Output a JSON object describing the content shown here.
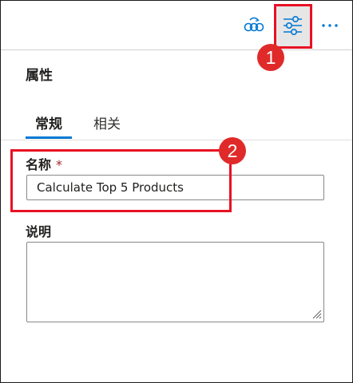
{
  "toolbar": {
    "buttons": [
      {
        "id": "data-flow",
        "icon": "data-flow-icon"
      },
      {
        "id": "properties",
        "icon": "settings-sliders-icon",
        "active": true
      },
      {
        "id": "more",
        "icon": "more-horizontal-icon"
      }
    ]
  },
  "annotations": {
    "callout_1": "1",
    "callout_2": "2",
    "highlight_color": "#e81123",
    "callout_color": "#e02a2a"
  },
  "panel": {
    "title": "属性",
    "tabs": [
      {
        "label": "常规",
        "selected": true
      },
      {
        "label": "相关",
        "selected": false
      }
    ],
    "name_field": {
      "label": "名称",
      "required_marker": "*",
      "value": "Calculate Top 5 Products"
    },
    "description_field": {
      "label": "说明",
      "value": ""
    }
  },
  "colors": {
    "accent": "#0078d4",
    "icon_blue": "#0078d4",
    "required": "#a4262c"
  }
}
